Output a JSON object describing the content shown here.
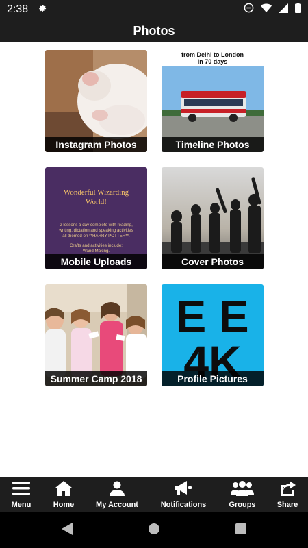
{
  "status_bar": {
    "time": "2:38",
    "icons": [
      "gear-icon",
      "do-not-disturb-icon",
      "wifi-icon",
      "signal-icon",
      "battery-icon"
    ]
  },
  "header": {
    "title": "Photos"
  },
  "albums": [
    {
      "label": "Instagram Photos",
      "thumb": "cat-photo"
    },
    {
      "label": "Timeline Photos",
      "thumb": "bus-poster",
      "poster_line1": "from Delhi to London",
      "poster_line2": "in 70 days"
    },
    {
      "label": "Mobile Uploads",
      "thumb": "wizarding-poster",
      "poster_title_line1": "Wonderful Wizarding",
      "poster_title_line2": "World!",
      "poster_text1": "2 lessons a day complete with reading,",
      "poster_text2": "writing, dictation and speaking activities",
      "poster_text3": "all themed on **HARRY POTTER**.",
      "poster_text4": "Crafts and activities include:",
      "poster_text5": "Wand Making."
    },
    {
      "label": "Cover Photos",
      "thumb": "silhouettes-photo"
    },
    {
      "label": "Summer Camp 2018",
      "thumb": "kids-photo"
    },
    {
      "label": "Profile Pictures",
      "thumb": "ee4k-logo",
      "logo_row1": "E E",
      "logo_row2": "4K"
    }
  ],
  "bottom_nav": [
    {
      "label": "Menu",
      "icon": "hamburger-icon"
    },
    {
      "label": "Home",
      "icon": "home-icon"
    },
    {
      "label": "My Account",
      "icon": "user-icon"
    },
    {
      "label": "Notifications",
      "icon": "megaphone-icon"
    },
    {
      "label": "Groups",
      "icon": "groups-icon"
    },
    {
      "label": "Share",
      "icon": "share-icon"
    }
  ],
  "system_nav": [
    "back-icon",
    "home-circle-icon",
    "recents-icon"
  ],
  "colors": {
    "bar": "#1e1e1e",
    "system_bar": "#000000",
    "ee4k_blue": "#19b2e8",
    "wizard_purple": "#4a2d62"
  }
}
